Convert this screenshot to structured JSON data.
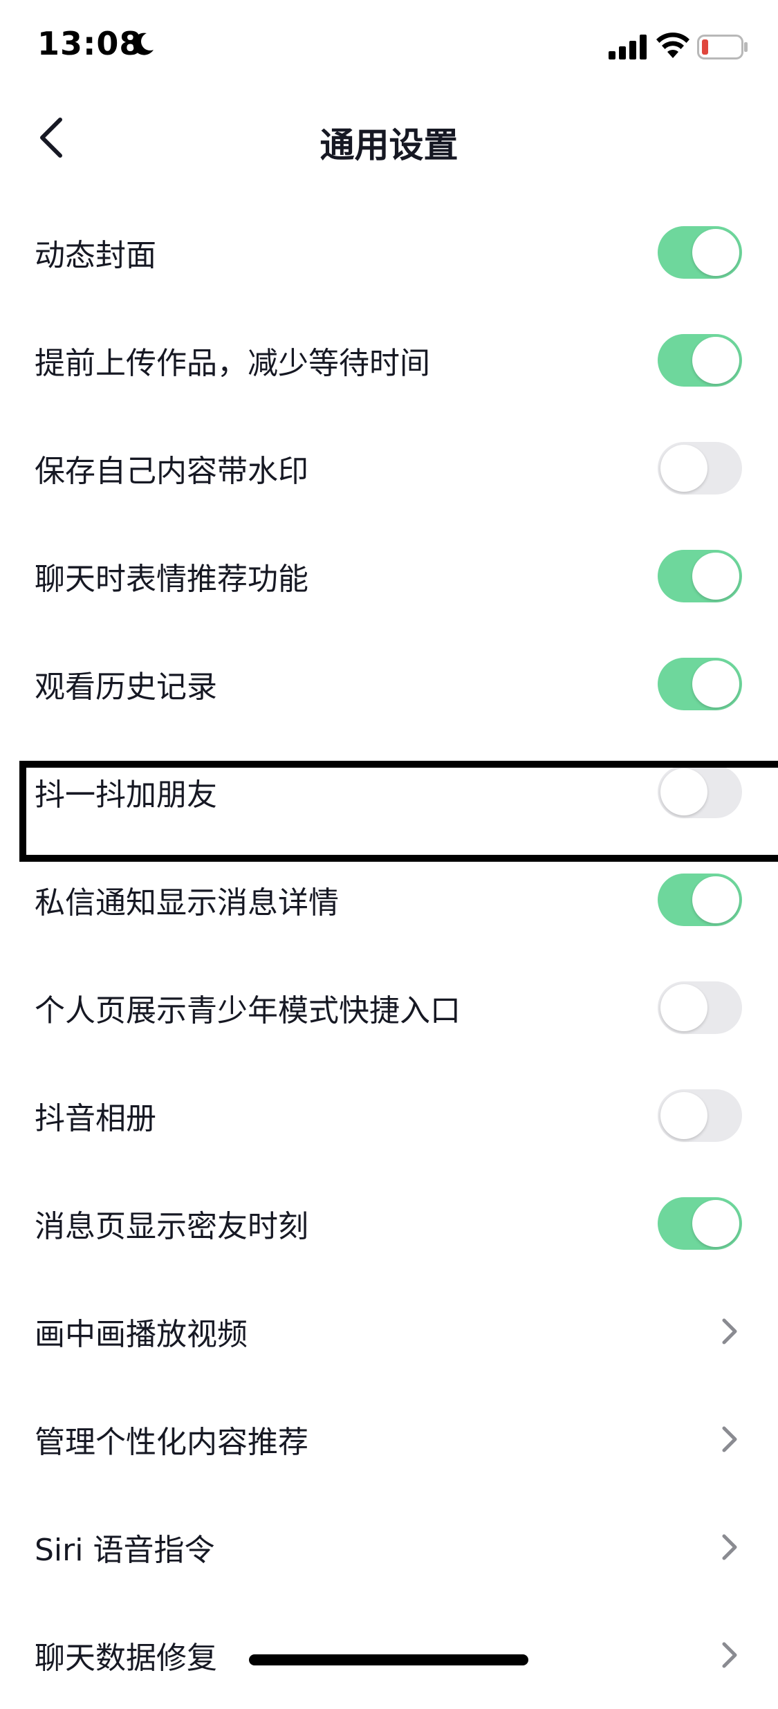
{
  "status_bar": {
    "time": "13:08",
    "battery_color": "#e0463d"
  },
  "nav": {
    "title": "通用设置"
  },
  "settings": [
    {
      "label": "动态封面",
      "type": "toggle",
      "on": true
    },
    {
      "label": "提前上传作品，减少等待时间",
      "type": "toggle",
      "on": true
    },
    {
      "label": "保存自己内容带水印",
      "type": "toggle",
      "on": false
    },
    {
      "label": "聊天时表情推荐功能",
      "type": "toggle",
      "on": true
    },
    {
      "label": "观看历史记录",
      "type": "toggle",
      "on": true
    },
    {
      "label": "抖一抖加朋友",
      "type": "toggle",
      "on": false
    },
    {
      "label": "私信通知显示消息详情",
      "type": "toggle",
      "on": true
    },
    {
      "label": "个人页展示青少年模式快捷入口",
      "type": "toggle",
      "on": false
    },
    {
      "label": "抖音相册",
      "type": "toggle",
      "on": false
    },
    {
      "label": "消息页显示密友时刻",
      "type": "toggle",
      "on": true
    },
    {
      "label": "画中画播放视频",
      "type": "link"
    },
    {
      "label": "管理个性化内容推荐",
      "type": "link"
    },
    {
      "label": "Siri 语音指令",
      "type": "link"
    },
    {
      "label": "聊天数据修复",
      "type": "link"
    }
  ],
  "colors": {
    "toggle_on": "#6ed79c",
    "toggle_off": "#e9e9ec",
    "text": "#161823"
  }
}
